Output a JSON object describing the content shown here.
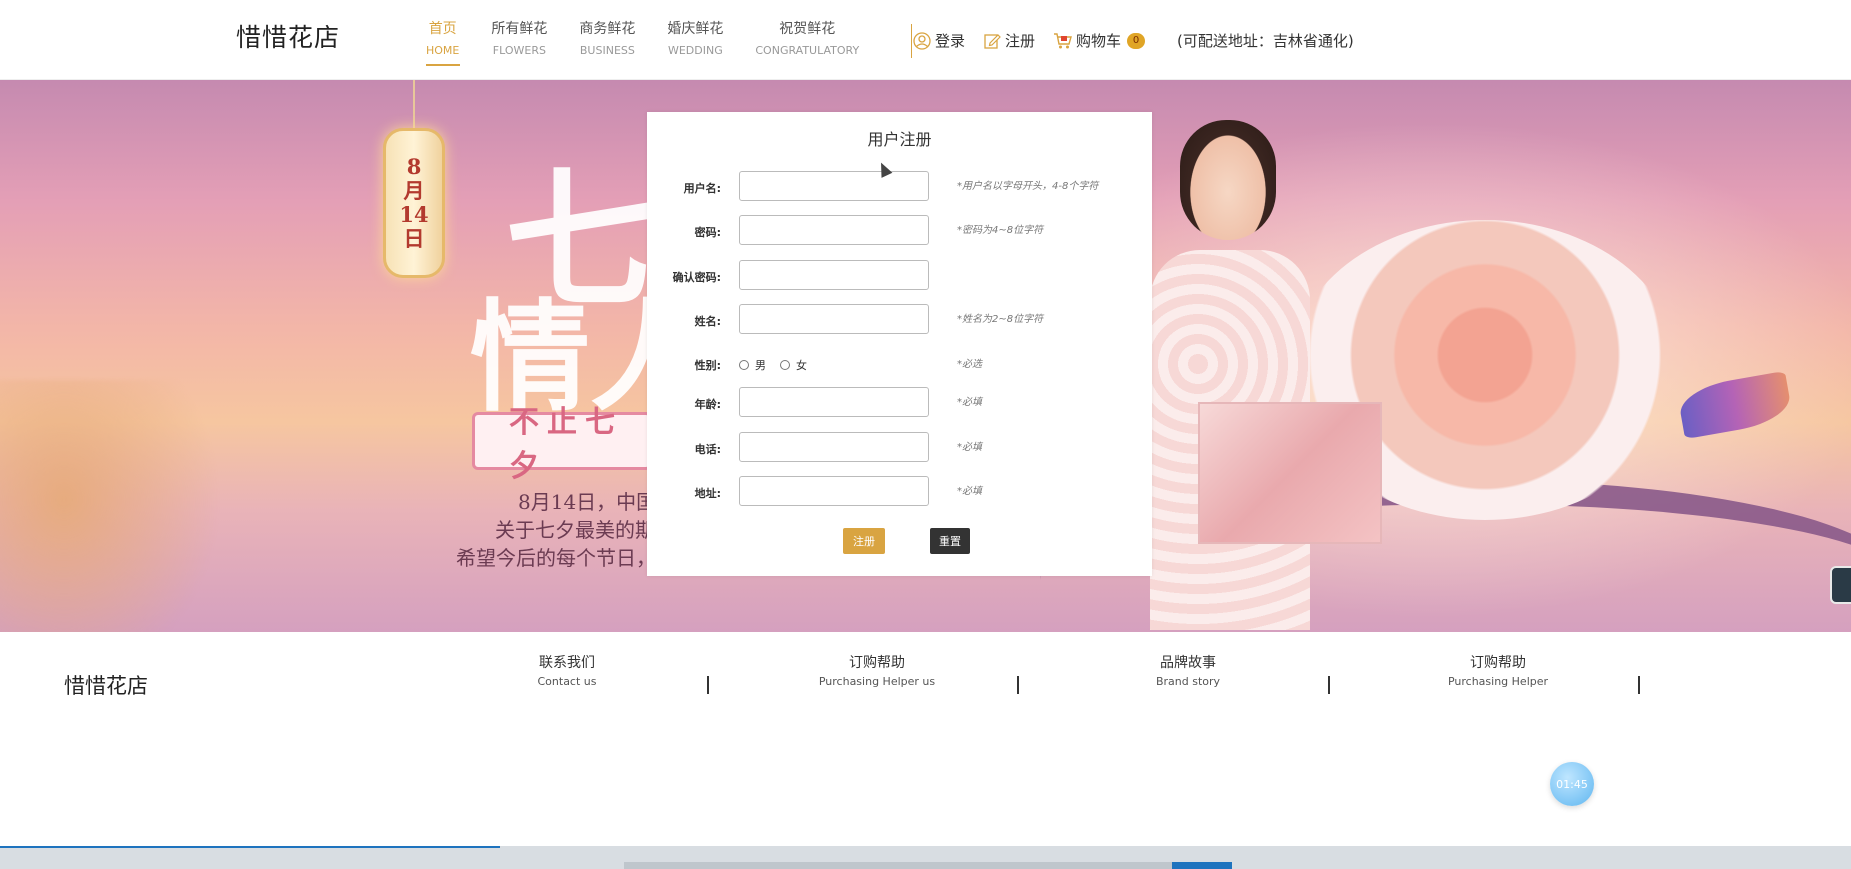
{
  "header": {
    "logo": "惜惜花店",
    "nav": [
      {
        "cn": "首页",
        "en": "HOME",
        "active": true
      },
      {
        "cn": "所有鲜花",
        "en": "FLOWERS"
      },
      {
        "cn": "商务鲜花",
        "en": "BUSINESS"
      },
      {
        "cn": "婚庆鲜花",
        "en": "WEDDING"
      },
      {
        "cn": "祝贺鲜花",
        "en": "CONGRATULATORY"
      }
    ],
    "login": "登录",
    "register": "注册",
    "cart": "购物车",
    "cart_count": "0",
    "address": "(可配送地址：吉林省通化)"
  },
  "banner": {
    "lantern": [
      "8",
      "月",
      "14",
      "日"
    ],
    "big1": "七",
    "big2": "情人",
    "ribbon": "不止七夕",
    "poem1": "8月14日，中国",
    "poem2": "关于七夕最美的期",
    "poem3": "希望今后的每个节日，"
  },
  "register": {
    "title": "用户注册",
    "username_label": "用户名:",
    "username_hint": "*用户名以字母开头，4-8个字符",
    "password_label": "密码:",
    "password_hint": "*密码为4~8位字符",
    "confirm_label": "确认密码:",
    "name_label": "姓名:",
    "name_hint": "*姓名为2~8位字符",
    "gender_label": "性别:",
    "gender_male": "男",
    "gender_female": "女",
    "gender_hint": "*必选",
    "age_label": "年龄:",
    "age_hint": "*必填",
    "phone_label": "电话:",
    "phone_hint": "*必填",
    "address_label": "地址:",
    "address_hint": "*必填",
    "submit": "注册",
    "reset": "重置"
  },
  "footer": {
    "logo": "惜惜花店",
    "links": [
      {
        "cn": "联系我们",
        "en": "Contact us"
      },
      {
        "cn": "订购帮助",
        "en": "Purchasing Helper us"
      },
      {
        "cn": "品牌故事",
        "en": "Brand story"
      },
      {
        "cn": "订购帮助",
        "en": "Purchasing Helper"
      }
    ],
    "timer": "01:45"
  },
  "colors": {
    "accent": "#d9a441",
    "dark_button": "#333333"
  }
}
